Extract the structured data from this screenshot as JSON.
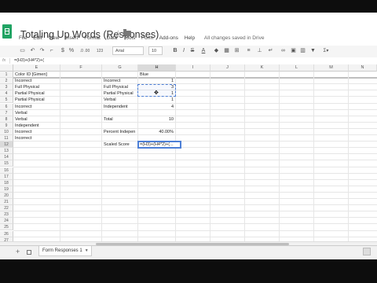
{
  "app": {
    "doc_title": "Totaling Up Words (Responses)",
    "menu": [
      "File",
      "Edit",
      "View",
      "Insert",
      "Format",
      "Data",
      "Tools",
      "Form",
      "Add-ons",
      "Help"
    ],
    "save_status": "All changes saved in Drive"
  },
  "toolbar": {
    "zoom_text": "123",
    "font_name": "Arial",
    "font_size": "10",
    "bold": "B",
    "italic": "I",
    "strike": "S",
    "text_color": "A",
    "format_dollar": "$",
    "format_percent": "%",
    "format_decimals": ".0 .00"
  },
  "formula": {
    "fx_label": "fx",
    "text": "=(H3)+(H4*2)+("
  },
  "columns": [
    "E",
    "F",
    "G",
    "H",
    "I",
    "J",
    "K",
    "L",
    "M",
    "N"
  ],
  "active_column": "H",
  "rows": [
    "1",
    "2",
    "3",
    "4",
    "5",
    "6",
    "7",
    "8",
    "9",
    "10",
    "11",
    "12",
    "13",
    "14",
    "15",
    "16",
    "17",
    "18",
    "19",
    "20",
    "21",
    "22",
    "23",
    "24",
    "25",
    "26",
    "27"
  ],
  "active_row": "12",
  "cells": {
    "E1": "Color ID [Gimen]",
    "H1": "Blue",
    "E2": "Incorrect",
    "E3": "Full Physical",
    "E4": "Partial Physical",
    "E5": "Partial Physical",
    "E6": "Incorrect",
    "E7": "Verbal",
    "E8": "Verbal",
    "E9": "Independent",
    "E10": "Incorrect",
    "E11": "Incorrect",
    "G2": "Incorrect",
    "G3": "Full Physical",
    "G4": "Partial Physical",
    "G5": "Verbal",
    "G6": "Independent",
    "G8": "Total",
    "G10": "Percent Indepen",
    "G12": "Scaled Score",
    "H2": "1",
    "H3": "3",
    "H4": "1",
    "H5": "1",
    "H6": "4",
    "H8": "10",
    "H10": "40.00%"
  },
  "active_cell_text": "=(H3)+(H4*2)+(...",
  "sheet_tab": "Form Responses 1",
  "colors": {
    "sheets_green": "#21a464",
    "selection_blue": "#4d7fd6"
  }
}
